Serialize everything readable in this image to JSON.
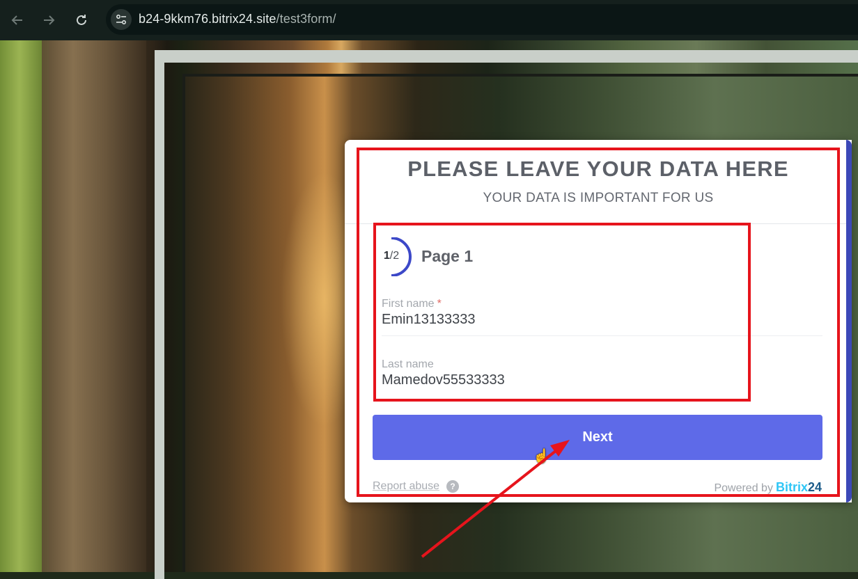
{
  "browser": {
    "url_domain": "b24-9kkm76.bitrix24.site",
    "url_path": "/test3form/"
  },
  "form": {
    "title": "PLEASE LEAVE YOUR DATA HERE",
    "subtitle": "YOUR DATA IS IMPORTANT FOR US",
    "progress_current": "1",
    "progress_total": "/2",
    "progress_fraction": 0.5,
    "page_title": "Page 1",
    "fields": [
      {
        "label": "First name",
        "required_mark": "*",
        "value": "Emin13133333"
      },
      {
        "label": "Last name",
        "value": "Mamedov55533333"
      }
    ],
    "next_label": "Next",
    "report_abuse": "Report abuse",
    "help_glyph": "?",
    "powered_by": "Powered by",
    "brand_name": "Bitrix",
    "brand_number": "24"
  },
  "colors": {
    "accent": "#5e6ae8",
    "annotation": "#e6141c",
    "brand": "#2fc6f6"
  }
}
